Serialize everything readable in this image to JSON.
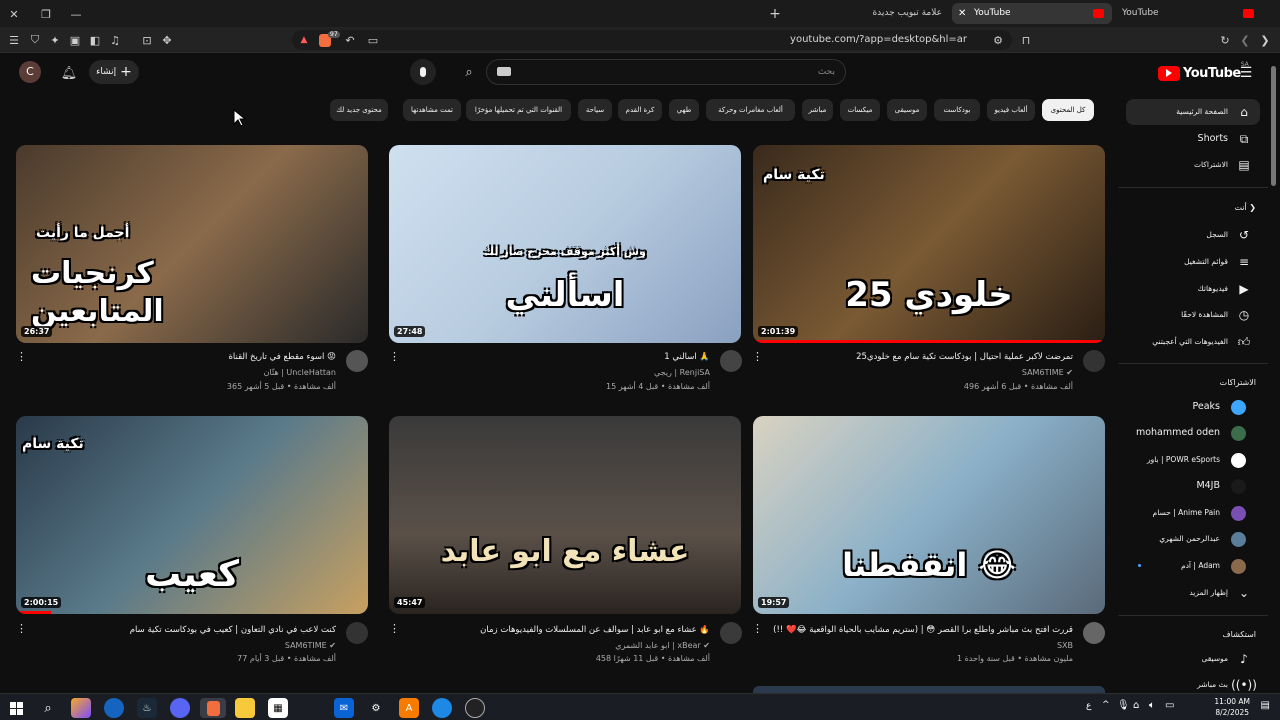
{
  "browser": {
    "tabs": [
      {
        "label": "علامة تبويب جديدة",
        "active": false
      },
      {
        "label": "YouTube",
        "active": true
      },
      {
        "label": "YouTube",
        "active": false
      }
    ],
    "url": "youtube.com/?app=desktop&hl=ar",
    "brave_badge": "97"
  },
  "header": {
    "logo_text": "YouTube",
    "country": "SA",
    "search_placeholder": "بحث",
    "create_label": "إنشاء",
    "avatar_letter": "C"
  },
  "chips": [
    {
      "label": "كل المحتوى",
      "selected": true
    },
    {
      "label": "ألعاب فيديو"
    },
    {
      "label": "بودكاست"
    },
    {
      "label": "موسيقى"
    },
    {
      "label": "ميكسات"
    },
    {
      "label": "مباشر"
    },
    {
      "label": "ألعاب مغامرات وحركة"
    },
    {
      "label": "طهي"
    },
    {
      "label": "كرة القدم"
    },
    {
      "label": "سياحة"
    },
    {
      "label": "القنوات التي تم تحميلها مؤخرًا"
    },
    {
      "label": "تمت مشاهدتها"
    },
    {
      "label": "محتوى جديد لك"
    }
  ],
  "sidebar": {
    "main": [
      {
        "label": "الصفحة الرئيسية",
        "icon": "home-icon",
        "active": true
      },
      {
        "label": "Shorts",
        "icon": "shorts-icon"
      },
      {
        "label": "الاشتراكات",
        "icon": "subscriptions-icon"
      }
    ],
    "you_header": "أنت",
    "you": [
      {
        "label": "السجل",
        "icon": "history-icon"
      },
      {
        "label": "قوائم التشغيل",
        "icon": "playlist-icon"
      },
      {
        "label": "فيديوهاتك",
        "icon": "your-videos-icon"
      },
      {
        "label": "المشاهدة لاحقًا",
        "icon": "watch-later-icon"
      },
      {
        "label": "الفيديوهات التي أعجبتني",
        "icon": "like-icon"
      }
    ],
    "subs_header": "الاشتراكات",
    "subs": [
      {
        "label": "Peaks",
        "color": "#3ea6ff"
      },
      {
        "label": "mohammed oden",
        "color": "#3b6d4a"
      },
      {
        "label": "باور | POWR eSports",
        "color": "#ffffff"
      },
      {
        "label": "M4JB",
        "color": "#1a1a1a"
      },
      {
        "label": "حسام | Anime Pain",
        "color": "#7a4fb3"
      },
      {
        "label": "عبدالرحمن الشهري",
        "color": "#5a7d9a"
      },
      {
        "label": "آدم | Adam",
        "color": "#8a6a4a"
      }
    ],
    "show_more": "إظهار المزيد",
    "explore_header": "استكشاف",
    "explore": [
      {
        "label": "موسيقى",
        "icon": "music-icon"
      },
      {
        "label": "بث مباشر",
        "icon": "live-icon"
      }
    ]
  },
  "videos": [
    {
      "title": "تمرضت لأكبر عملية احتيال | بودكاست تكية سام مع خلودي25",
      "channel": "SAM6TIME",
      "verified": true,
      "meta": "496 ألف مشاهدة • قبل 6 أشهر",
      "duration": "2:01:39",
      "thumb_text": "خلودي 25",
      "thumb_sub": "تكية سام",
      "bg": "linear-gradient(135deg,#3a2a1c,#7a5a34 50%,#2a1e14)",
      "progress": 1.0,
      "av": "#333"
    },
    {
      "title": "اسألني 1 🙏",
      "channel": "ريجي | RenjiSA",
      "verified": false,
      "meta": "15 ألف مشاهدة • قبل 4 أشهر",
      "duration": "27:48",
      "thumb_text": "اسألني",
      "thumb_sub": "وش أكثر موقف محرج صار لك",
      "bg": "linear-gradient(135deg,#cfe0f0,#b8cce0 50%,#8aa0c0)",
      "progress": 0,
      "av": "#444"
    },
    {
      "title": "اسوء مقطع في تاريخ القناة 😡",
      "channel": "هتّان | UncleHattan",
      "verified": false,
      "meta": "365 ألف مشاهدة • قبل 5 أشهر",
      "duration": "26:37",
      "thumb_text": "كرنجيات المتابعين",
      "thumb_sub": "أجمل ما رأيت",
      "bg": "linear-gradient(135deg,#4a3a2c,#8a6a4a 50%,#2a2a2a)",
      "progress": 0,
      "av": "#555"
    },
    {
      "title": "قررت افتح بث مباشر واطلع برا القصر 😳 | (ستريم مشايب بالحياة الواقعية 😂❤️ !!)",
      "channel": "SXB",
      "verified": false,
      "meta": "1 مليون مشاهدة • قبل سنة واحدة",
      "duration": "19:57",
      "thumb_text": "انقفطنا 😂",
      "thumb_sub": "",
      "bg": "linear-gradient(135deg,#d9d2c2,#8ab0c8 50%,#5a6a7a)",
      "progress": 0,
      "av": "#666"
    },
    {
      "title": "عشاء مع ابو عابد | سوالف عن المسلسلات والفيديوهات زمان 🔥",
      "channel": "ابو عابد الشمري | xBear",
      "verified": true,
      "meta": "458 ألف مشاهدة • قبل 11 شهرًا",
      "duration": "45:47",
      "thumb_text": "عشاء مع ابو عابد",
      "thumb_sub": "",
      "bg": "linear-gradient(180deg,#3a3a3a,#5a5048 60%,#2a2420)",
      "progress": 0,
      "av": "#3a3a3a"
    },
    {
      "title": "كنت لاعب في نادي التعاون | كعيب في بودكاست تكية سام",
      "channel": "SAM6TIME",
      "verified": true,
      "meta": "77 ألف مشاهدة • قبل 3 أيام",
      "duration": "2:00:15",
      "thumb_text": "كعيب",
      "thumb_sub": "تكية سام",
      "bg": "linear-gradient(135deg,#2a3a4a,#5a7a8a 50%,#c8a060)",
      "progress": 0.1,
      "av": "#333"
    }
  ],
  "taskbar": {
    "time": "11:00 AM",
    "date": "8/2/2025",
    "lang": "ع"
  }
}
